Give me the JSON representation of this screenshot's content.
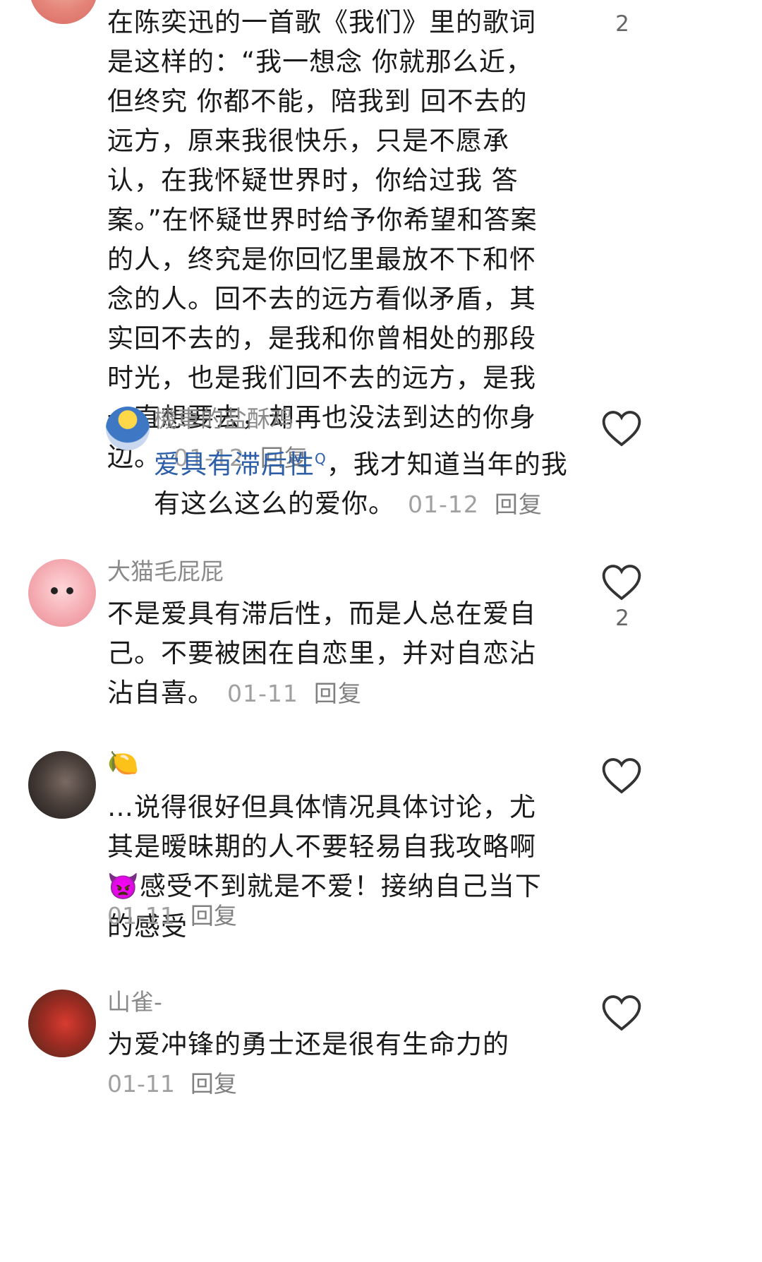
{
  "comments": [
    {
      "id": "c1",
      "username": "",
      "segments": [
        "在陈奕迅的一首歌《我们》里的歌词是这样的：“我一想念 你就那么近，但终究 你都不能，陪我到 回不去的 远方，原来我很快乐，只是不愿承认，在我怀疑世界时，你给过我 答案。”在怀疑世界时给予你希望和答案的人，终究是你回忆里最放不下和怀念的人。回不去的远方看似矛盾，其实回不去的，是我和你曾相处的那段时光，也是我们回不去的远方，是我一直想要去，却再也没法到达的你身边。"
      ],
      "date": "01-12",
      "reply_label": "回复",
      "like_count": "2"
    },
    {
      "id": "c2",
      "username": "機車的盐酥鸡",
      "link_text": "爱具有滞后性",
      "search_mark": "Q",
      "text_after": "，我才知道当年的我有这么这么的爱你。",
      "date": "01-12",
      "reply_label": "回复",
      "like_count": ""
    },
    {
      "id": "c3",
      "username": "大猫毛屁屁",
      "text": "不是爱具有滞后性，而是人总在爱自己。不要被困在自恋里，并对自恋沾沾自喜。",
      "date": "01-11",
      "reply_label": "回复",
      "like_count": "2"
    },
    {
      "id": "c4",
      "username_emoji": "🍋",
      "text_before": "…说得很好但具体情况具体讨论，尤其是暧昧期的人不要轻易自我攻略啊",
      "emoji": "👿",
      "text_after": "感受不到就是不爱！接纳自己当下的感受",
      "date": "01-11",
      "reply_label": "回复",
      "like_count": ""
    },
    {
      "id": "c5",
      "username": "山雀-",
      "text": "为爱冲锋的勇士还是很有生命力的",
      "date": "01-11",
      "reply_label": "回复",
      "like_count": ""
    }
  ],
  "icons": {
    "like": "heart-outline-icon"
  }
}
